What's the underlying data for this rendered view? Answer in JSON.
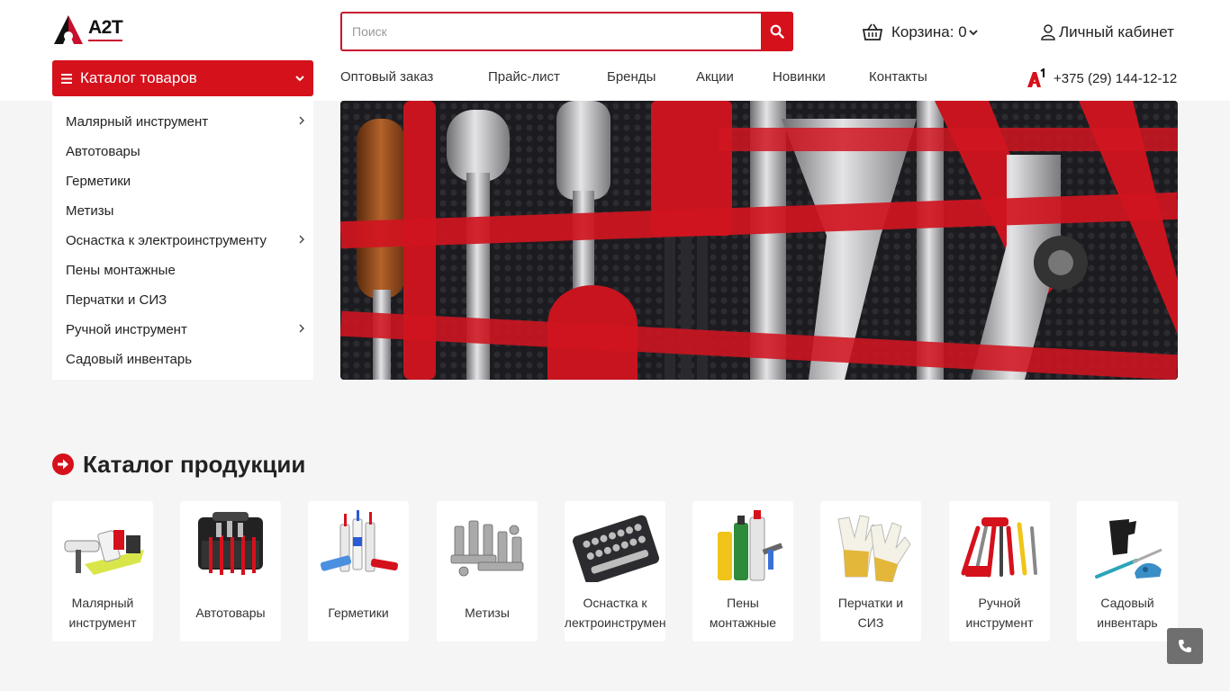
{
  "brand": {
    "name": "A2T",
    "accent": "#d5111c"
  },
  "search": {
    "placeholder": "Поиск"
  },
  "cart": {
    "label": "Корзина: 0"
  },
  "account": {
    "label": "Личный кабинет"
  },
  "catalog_button": {
    "label": "Каталог товаров"
  },
  "nav": [
    "Оптовый заказ",
    "Прайс-лист",
    "Бренды",
    "Акции",
    "Новинки",
    "Контакты"
  ],
  "phone": {
    "number": "+375 (29) 144-12-12",
    "operator_logo": "A1"
  },
  "sidebar": {
    "items": [
      {
        "label": "Малярный инструмент",
        "has_submenu": true
      },
      {
        "label": "Автотовары",
        "has_submenu": false
      },
      {
        "label": "Герметики",
        "has_submenu": false
      },
      {
        "label": "Метизы",
        "has_submenu": false
      },
      {
        "label": "Оснастка к электроинструменту",
        "has_submenu": true
      },
      {
        "label": "Пены монтажные",
        "has_submenu": false
      },
      {
        "label": "Перчатки и СИЗ",
        "has_submenu": false
      },
      {
        "label": "Ручной инструмент",
        "has_submenu": true
      },
      {
        "label": "Садовый инвентарь",
        "has_submenu": false
      }
    ]
  },
  "section": {
    "title": "Каталог продукции"
  },
  "products": [
    {
      "label": "Малярный\nинструмент",
      "icon": "paint-tools-icon"
    },
    {
      "label": "Автотовары",
      "icon": "car-tools-icon"
    },
    {
      "label": "Герметики",
      "icon": "sealant-tubes-icon"
    },
    {
      "label": "Метизы",
      "icon": "bolts-icon"
    },
    {
      "label": "Оснастка к\nэлектроинструмент",
      "icon": "socket-set-icon"
    },
    {
      "label": "Пены\nмонтажные",
      "icon": "foam-cans-icon"
    },
    {
      "label": "Перчатки и\nСИЗ",
      "icon": "gloves-icon"
    },
    {
      "label": "Ручной\nинструмент",
      "icon": "hand-tools-icon"
    },
    {
      "label": "Садовый\nинвентарь",
      "icon": "garden-tools-icon"
    }
  ]
}
